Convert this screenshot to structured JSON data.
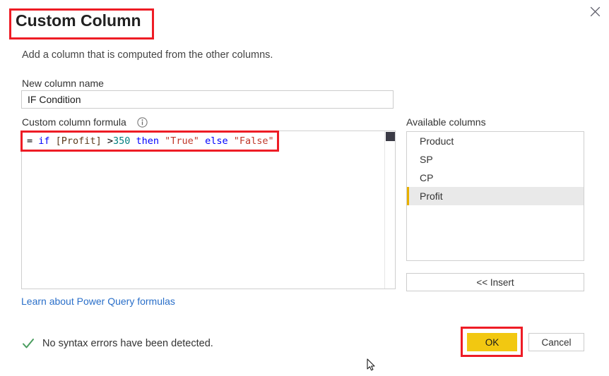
{
  "dialog": {
    "title": "Custom Column",
    "subtitle": "Add a column that is computed from the other columns.",
    "close_icon": "close-icon"
  },
  "new_column": {
    "label": "New column name",
    "value": "IF Condition",
    "placeholder": ""
  },
  "formula": {
    "label": "Custom column formula",
    "info_icon": "info-icon",
    "text": "= if [Profit] >350 then \"True\" else \"False\"",
    "tokens": [
      {
        "text": "= ",
        "type": "op"
      },
      {
        "text": "if",
        "type": "kw"
      },
      {
        "text": " ",
        "type": "op"
      },
      {
        "text": "[Profit]",
        "type": "col"
      },
      {
        "text": " >",
        "type": "op"
      },
      {
        "text": "350",
        "type": "num"
      },
      {
        "text": " ",
        "type": "op"
      },
      {
        "text": "then",
        "type": "kw"
      },
      {
        "text": " ",
        "type": "op"
      },
      {
        "text": "\"True\"",
        "type": "str"
      },
      {
        "text": " ",
        "type": "op"
      },
      {
        "text": "else",
        "type": "kw"
      },
      {
        "text": " ",
        "type": "op"
      },
      {
        "text": "\"False\"",
        "type": "str"
      }
    ],
    "learn_link": "Learn about Power Query formulas"
  },
  "available_columns": {
    "label": "Available columns",
    "items": [
      {
        "label": "Product",
        "selected": false
      },
      {
        "label": "SP",
        "selected": false
      },
      {
        "label": "CP",
        "selected": false
      },
      {
        "label": "Profit",
        "selected": true
      }
    ],
    "insert_label": "<< Insert"
  },
  "status": {
    "icon": "check-icon",
    "message": "No syntax errors have been detected."
  },
  "footer": {
    "ok_label": "OK",
    "cancel_label": "Cancel"
  },
  "colors": {
    "accent_yellow": "#f2c811",
    "annotation_red": "#ee1c25",
    "link_blue": "#2a6fc9",
    "status_green": "#4a9d5f",
    "selection_gold": "#e8b000",
    "keyword_blue": "#0000ff",
    "string_red": "#c0392b",
    "number_teal": "#008080",
    "column_brown": "#5c3c1e"
  }
}
